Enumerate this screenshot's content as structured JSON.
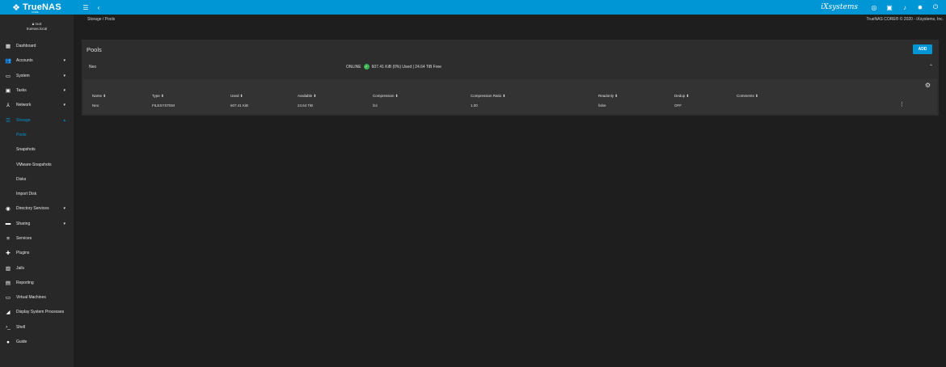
{
  "topbar": {
    "logo_text": "TrueNAS",
    "logo_sub": "CORE",
    "vendor": "iXsystems"
  },
  "user": {
    "name": "root",
    "host": "truenas.local"
  },
  "sidebar": {
    "items": [
      {
        "label": "Dashboard",
        "icon": "dashboard-icon",
        "glyph": "▦",
        "has_chev": false
      },
      {
        "label": "Accounts",
        "icon": "accounts-icon",
        "glyph": "👥",
        "has_chev": true
      },
      {
        "label": "System",
        "icon": "system-icon",
        "glyph": "▭",
        "has_chev": true
      },
      {
        "label": "Tasks",
        "icon": "tasks-icon",
        "glyph": "▣",
        "has_chev": true
      },
      {
        "label": "Network",
        "icon": "network-icon",
        "glyph": "⅄",
        "has_chev": true
      },
      {
        "label": "Storage",
        "icon": "storage-icon",
        "glyph": "☰",
        "has_chev": true,
        "active": true
      }
    ],
    "storage_sub": [
      "Pools",
      "Snapshots",
      "VMware-Snapshots",
      "Disks",
      "Import Disk"
    ],
    "items2": [
      {
        "label": "Directory Services",
        "icon": "directory-services-icon",
        "glyph": "◉",
        "has_chev": true
      },
      {
        "label": "Sharing",
        "icon": "sharing-icon",
        "glyph": "▬",
        "has_chev": true
      },
      {
        "label": "Services",
        "icon": "services-icon",
        "glyph": "≡",
        "has_chev": false
      },
      {
        "label": "Plugins",
        "icon": "plugins-icon",
        "glyph": "✚",
        "has_chev": false
      },
      {
        "label": "Jails",
        "icon": "jails-icon",
        "glyph": "▥",
        "has_chev": false
      },
      {
        "label": "Reporting",
        "icon": "reporting-icon",
        "glyph": "▤",
        "has_chev": false
      },
      {
        "label": "Virtual Machines",
        "icon": "virtual-machines-icon",
        "glyph": "▭",
        "has_chev": false
      },
      {
        "label": "Display System Processes",
        "icon": "processes-icon",
        "glyph": "◢",
        "has_chev": false
      },
      {
        "label": "Shell",
        "icon": "shell-icon",
        "glyph": "›_",
        "has_chev": false
      },
      {
        "label": "Guide",
        "icon": "guide-icon",
        "glyph": "●",
        "has_chev": false
      }
    ]
  },
  "breadcrumb": "Storage  /   Pools",
  "copyright": "TrueNAS CORE® © 2020 - iXsystems, Inc.",
  "card": {
    "title": "Pools",
    "add_label": "ADD",
    "pool": {
      "name": "Neo",
      "status": "ONLINE",
      "usage": "607.41 KiB (0%) Used  |  24.64 TiB Free"
    },
    "columns": [
      "Name",
      "Type",
      "Used",
      "Available",
      "Compression",
      "Compression Ratio",
      "Readonly",
      "Dedup",
      "Comments"
    ],
    "row": [
      "Neo",
      "FILESYSTEM",
      "607.41 KiB",
      "24.64 TiB",
      "lz4",
      "1.00",
      "false",
      "OFF",
      ""
    ]
  }
}
